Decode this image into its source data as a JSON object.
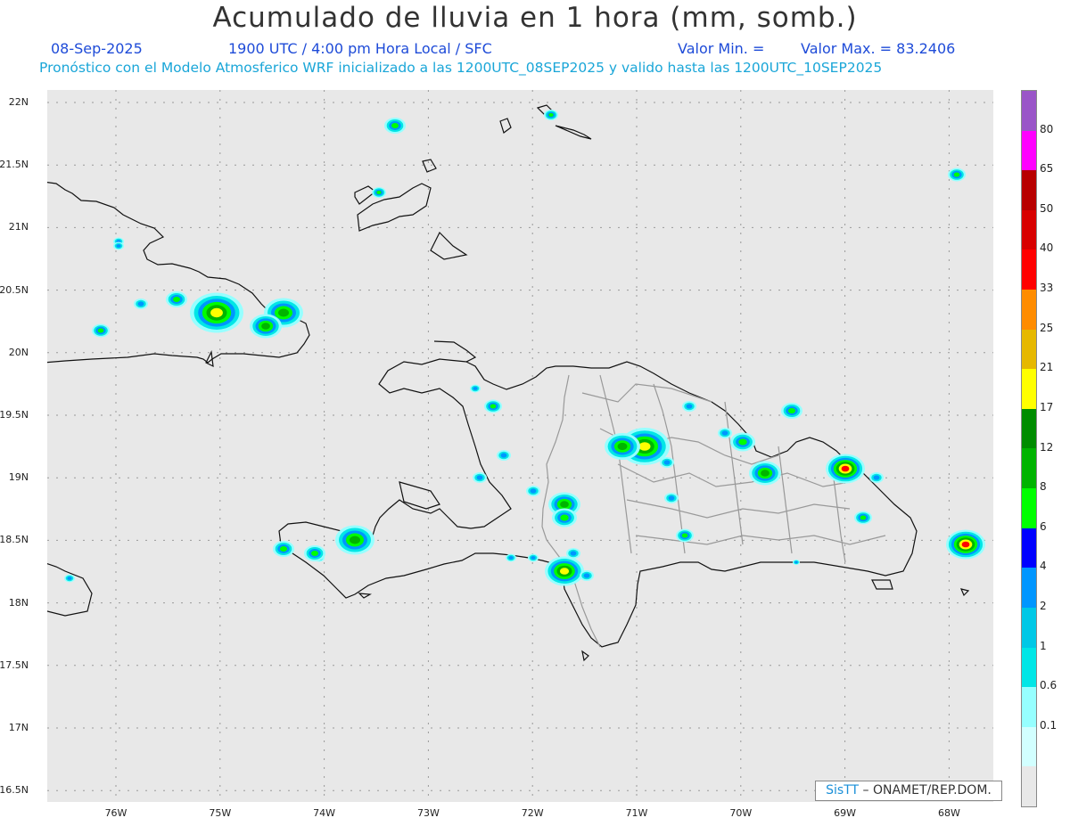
{
  "header": {
    "title": "Acumulado de lluvia en 1 hora (mm, somb.)",
    "date": "08-Sep-2025",
    "time": "1900 UTC / 4:00 pm Hora Local / SFC",
    "min_label": "Valor Min. =",
    "max_label": "Valor Max. = 83.2406",
    "forecast": "Pronóstico con el Modelo Atmosferico WRF inicializado a las 1200UTC_08SEP2025 y valido hasta las 1200UTC_10SEP2025"
  },
  "axes": {
    "lat_labels": [
      "22N",
      "21.5N",
      "21N",
      "20.5N",
      "20N",
      "19.5N",
      "19N",
      "18.5N",
      "18N",
      "17.5N",
      "17N",
      "16.5N"
    ],
    "lon_labels": [
      "76W",
      "75W",
      "74W",
      "73W",
      "72W",
      "71W",
      "70W",
      "69W",
      "68W"
    ],
    "lat_range": [
      16.45,
      22.1
    ],
    "lon_range": [
      76.65,
      67.65
    ]
  },
  "colorbar": {
    "labels": [
      "80",
      "65",
      "50",
      "40",
      "33",
      "25",
      "21",
      "17",
      "12",
      "8",
      "6",
      "4",
      "2",
      "1",
      "0.6",
      "0.1"
    ],
    "colors": [
      "#9a55c8",
      "#ff00ff",
      "#b80000",
      "#d80000",
      "#ff0000",
      "#ff8c00",
      "#e6b800",
      "#ffff00",
      "#008c00",
      "#00b400",
      "#00ff00",
      "#0000ff",
      "#0096ff",
      "#00c8e6",
      "#00e6e6",
      "#96ffff",
      "#d2ffff",
      "#e8e8e8"
    ]
  },
  "credit": {
    "brand": "SisTT",
    "text": "– ONAMET/REP.DOM."
  }
}
